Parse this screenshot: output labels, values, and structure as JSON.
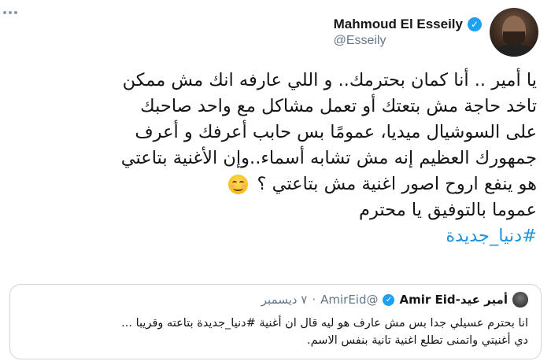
{
  "author": {
    "display_name": "Mahmoud El Esseily",
    "handle": "@Esseily",
    "avatar_icon": "profile-photo",
    "verified_icon": "verified-badge-icon"
  },
  "tweet": {
    "lines": [
      "يا أمير .. أنا كمان بحترمك.. و اللي عارفه انك مش ممكن",
      "تاخد حاجة مش بتعتك أو تعمل مشاكل  مع واحد صاحبك",
      "على السوشيال ميديا،  عمومًا بس حابب أعرفك و أعرف",
      "جمهورك العظيم إنه مش تشابه أسماء..وإن الأغنية بتاعتي",
      "هو ينفع اروح اصور اغنية مش بتاعتي ؟",
      "عموما بالتوفيق يا محترم"
    ],
    "emoji": "smiling-face-with-smiling-eyes",
    "hashtag": "#دنيا_جديدة"
  },
  "quoted_tweet": {
    "display_name": "أمير عيد-Amir Eid",
    "handle": "@AmirEid",
    "separator": "·",
    "date": "٧ ديسمبر",
    "lines": [
      "انا بحترم عسيلي جدا بس مش عارف هو ليه قال ان أغنية #دنيا_جديدة بتاعته وقريبا ...",
      "دي أغنيتي واتمنى تطلع اغنية تانية بنفس الاسم."
    ]
  },
  "colors": {
    "link": "#1b95e0",
    "verified": "#1da1f2",
    "secondary_text": "#657786",
    "border": "#ccd6dd"
  }
}
